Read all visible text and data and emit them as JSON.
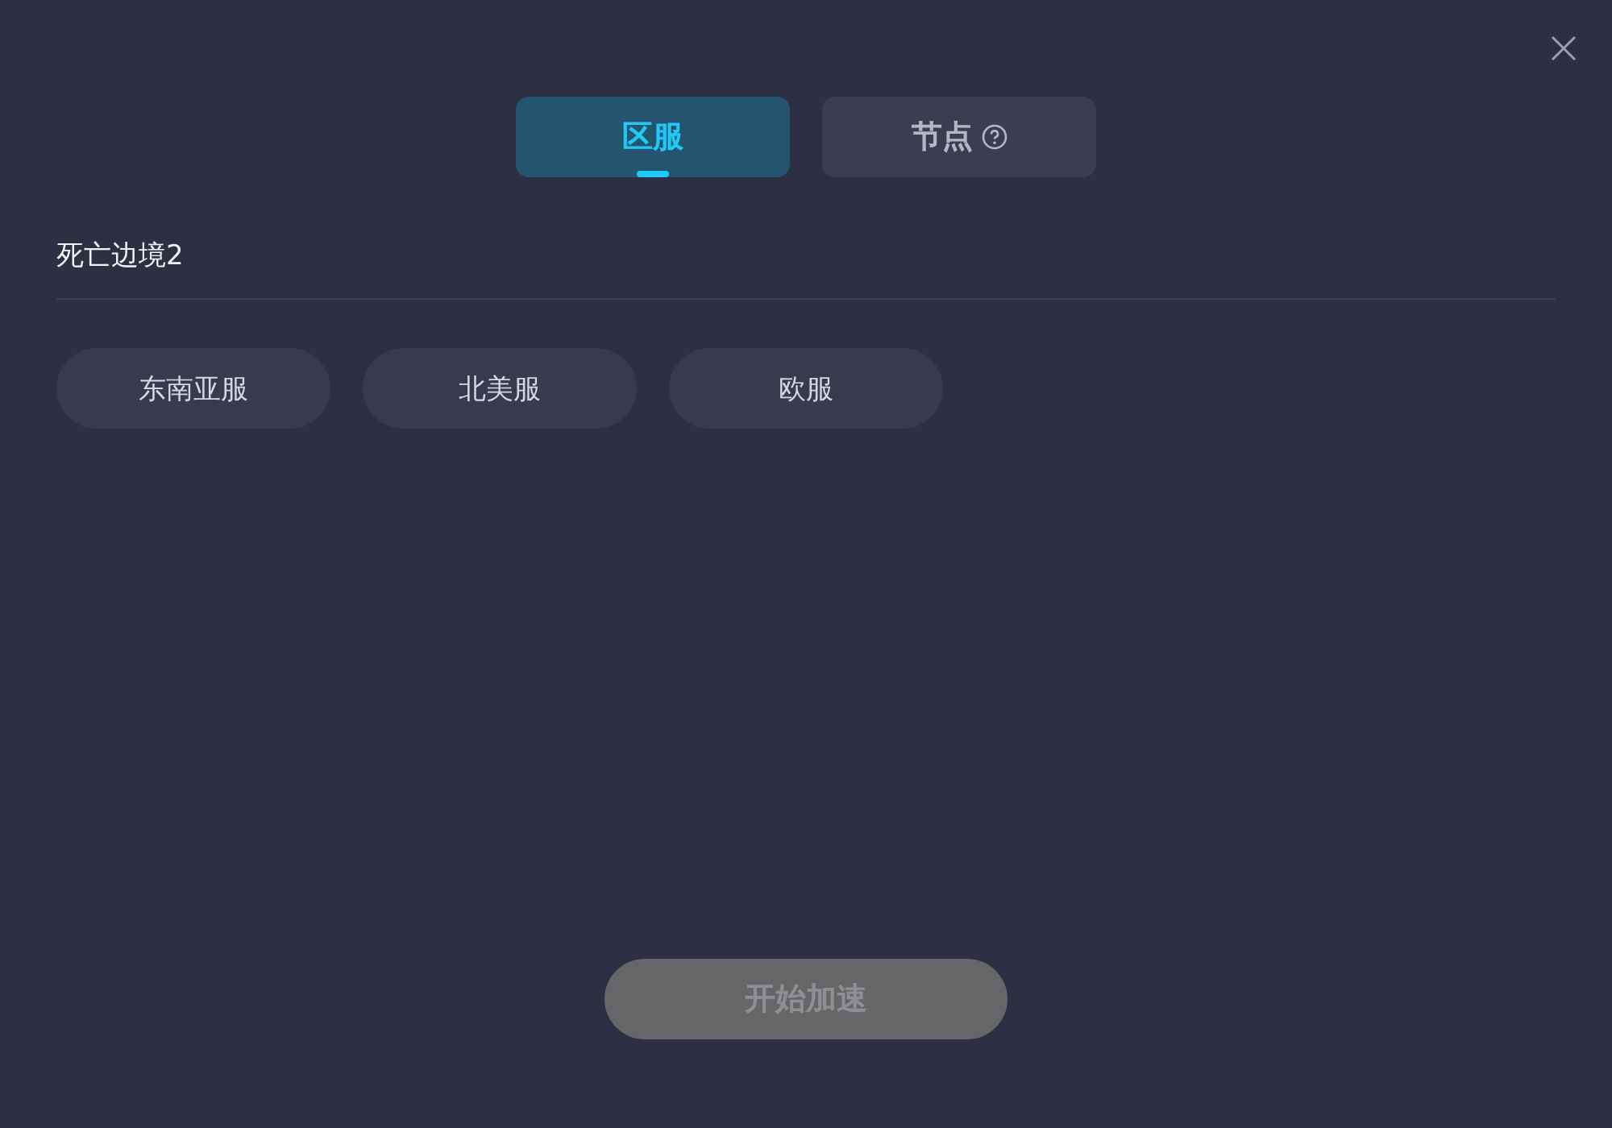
{
  "tabs": [
    {
      "label": "区服",
      "selected": true,
      "help": false
    },
    {
      "label": "节点",
      "selected": false,
      "help": true
    }
  ],
  "game_title": "死亡边境2",
  "regions": [
    {
      "label": "东南亚服",
      "selected": false
    },
    {
      "label": "北美服",
      "selected": false
    },
    {
      "label": "欧服",
      "selected": false
    }
  ],
  "start_button": {
    "label": "开始加速",
    "disabled": true
  }
}
